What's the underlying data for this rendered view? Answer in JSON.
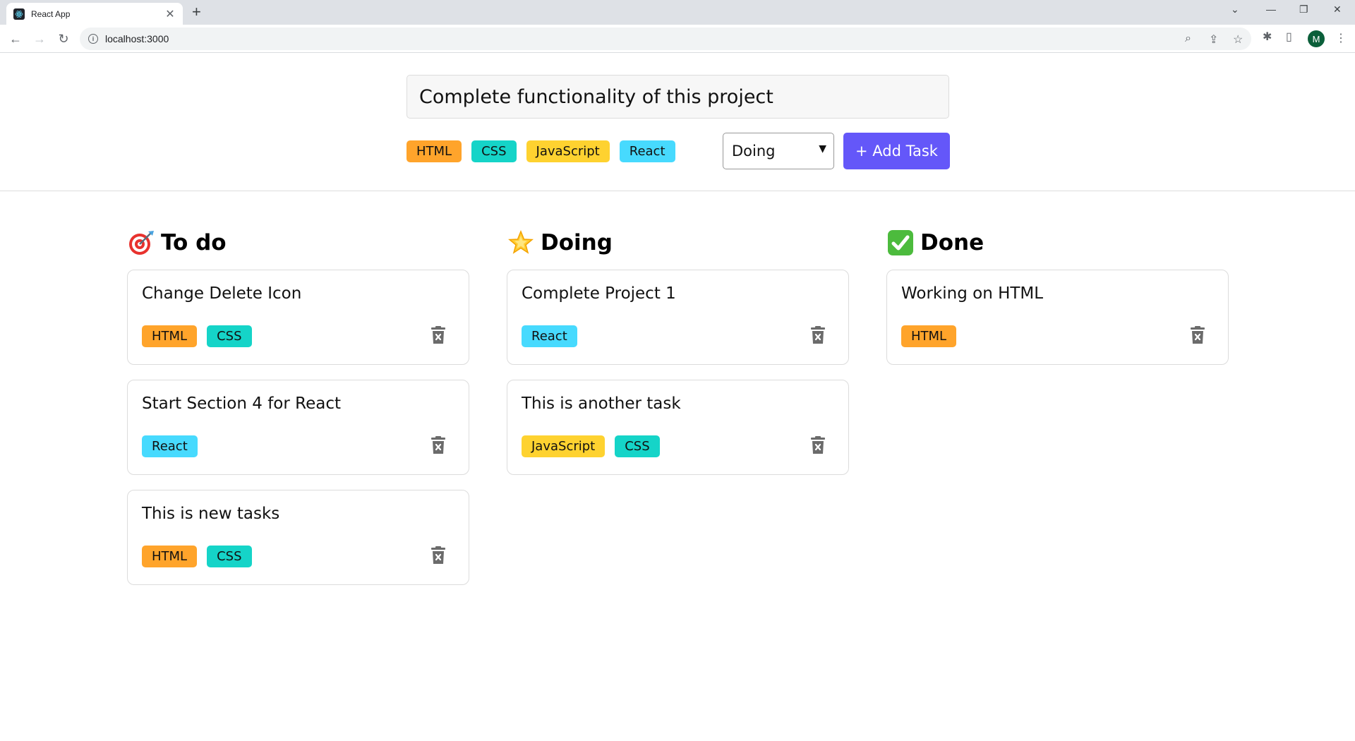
{
  "browser": {
    "tab_title": "React App",
    "url": "localhost:3000",
    "profile_initial": "M"
  },
  "form": {
    "task_value": "Complete functionality of this project",
    "tags": [
      {
        "label": "HTML",
        "color": "#ffa42b"
      },
      {
        "label": "CSS",
        "color": "#15d4c8"
      },
      {
        "label": "JavaScript",
        "color": "#fed230"
      },
      {
        "label": "React",
        "color": "#47dafe"
      }
    ],
    "status_selected": "Doing",
    "add_button": "+ Add Task",
    "accent": "#6457f9"
  },
  "columns": [
    {
      "title": "To do",
      "icon": "direct-hit-icon",
      "cards": [
        {
          "title": "Change Delete Icon",
          "tags": [
            "HTML",
            "CSS"
          ]
        },
        {
          "title": "Start Section 4 for React",
          "tags": [
            "React"
          ]
        },
        {
          "title": "This is new tasks",
          "tags": [
            "HTML",
            "CSS"
          ]
        }
      ]
    },
    {
      "title": "Doing",
      "icon": "glowing-star-icon",
      "cards": [
        {
          "title": "Complete Project 1",
          "tags": [
            "React"
          ]
        },
        {
          "title": "This is another task",
          "tags": [
            "JavaScript",
            "CSS"
          ]
        }
      ]
    },
    {
      "title": "Done",
      "icon": "check-mark-button-icon",
      "cards": [
        {
          "title": "Working on HTML",
          "tags": [
            "HTML"
          ]
        }
      ]
    }
  ],
  "tag_colors": {
    "HTML": "#ffa42b",
    "CSS": "#15d4c8",
    "JavaScript": "#fed230",
    "React": "#47dafe"
  }
}
